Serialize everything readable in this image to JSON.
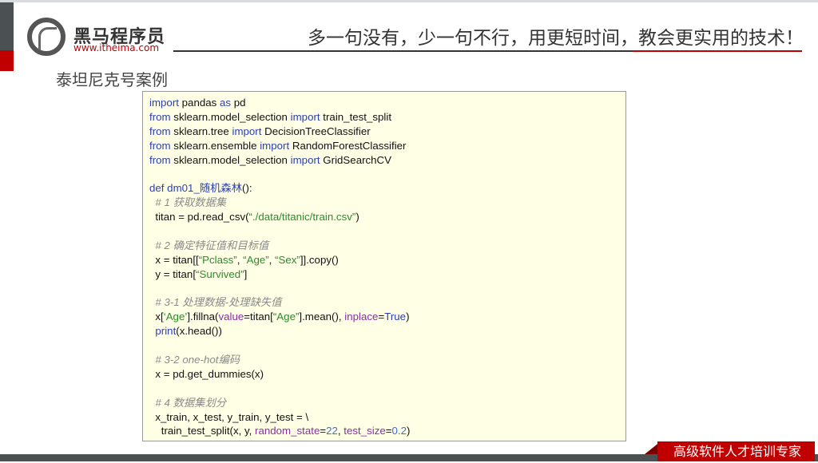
{
  "header": {
    "brand": "黑马程序员",
    "url": "www.itheima.com",
    "slogan": "多一句没有，少一句不行，用更短时间，教会更实用的技术！"
  },
  "title": "泰坦尼克号案例",
  "code_lines": [
    [
      [
        "import",
        "kw"
      ],
      [
        " pandas ",
        ""
      ],
      [
        "as",
        "kw"
      ],
      [
        " pd",
        ""
      ]
    ],
    [
      [
        "from",
        "kw"
      ],
      [
        " sklearn.model_selection ",
        ""
      ],
      [
        "import",
        "kw"
      ],
      [
        " train_test_split",
        ""
      ]
    ],
    [
      [
        "from",
        "kw"
      ],
      [
        " sklearn.tree ",
        ""
      ],
      [
        "import",
        "kw"
      ],
      [
        " DecisionTreeClassifier",
        ""
      ]
    ],
    [
      [
        "from",
        "kw"
      ],
      [
        " sklearn.ensemble ",
        ""
      ],
      [
        "import",
        "kw"
      ],
      [
        " RandomForestClassifier",
        ""
      ]
    ],
    [
      [
        "from",
        "kw"
      ],
      [
        " sklearn.model_selection ",
        ""
      ],
      [
        "import",
        "kw"
      ],
      [
        " GridSearchCV",
        ""
      ]
    ],
    [],
    [
      [
        "def dm01_随机森林",
        "kw"
      ],
      [
        "():",
        ""
      ]
    ],
    [
      [
        "  # 1 获取数据集",
        "cm"
      ]
    ],
    [
      [
        "  titan = pd.read_csv(",
        ""
      ],
      [
        "“./data/titanic/train.csv”",
        "str"
      ],
      [
        ")",
        ""
      ]
    ],
    [],
    [
      [
        "  # 2 确定特征值和目标值",
        "cm"
      ]
    ],
    [
      [
        "  x = titan[[",
        ""
      ],
      [
        "“Pclass”",
        "str"
      ],
      [
        ", ",
        ""
      ],
      [
        "“Age”",
        "str"
      ],
      [
        ", ",
        ""
      ],
      [
        "“Sex”",
        "str"
      ],
      [
        "]].copy()",
        ""
      ]
    ],
    [
      [
        "  y = titan[",
        ""
      ],
      [
        "“Survived”",
        "str"
      ],
      [
        "]",
        ""
      ]
    ],
    [],
    [
      [
        "  # 3-1 处理数据-处理缺失值",
        "cm"
      ]
    ],
    [
      [
        "  x[",
        ""
      ],
      [
        "‘Age’",
        "str"
      ],
      [
        "].fillna(",
        ""
      ],
      [
        "value",
        "par"
      ],
      [
        "=titan[",
        ""
      ],
      [
        "“Age”",
        "str"
      ],
      [
        "].mean(), ",
        ""
      ],
      [
        "inplace",
        "par"
      ],
      [
        "=",
        ""
      ],
      [
        "True",
        "kw"
      ],
      [
        ")",
        ""
      ]
    ],
    [
      [
        "  ",
        ""
      ],
      [
        "print",
        "kw"
      ],
      [
        "(x.head())",
        ""
      ]
    ],
    [],
    [
      [
        "  # 3-2 one-hot编码",
        "cm"
      ]
    ],
    [
      [
        "  x = pd.get_dummies(x)",
        ""
      ]
    ],
    [],
    [
      [
        "  # 4 数据集划分",
        "cm"
      ]
    ],
    [
      [
        "  x_train, x_test, y_train, y_test = \\",
        ""
      ]
    ],
    [
      [
        "    train_test_split(x, y, ",
        ""
      ],
      [
        "random_state",
        "par"
      ],
      [
        "=",
        ""
      ],
      [
        "22",
        "num"
      ],
      [
        ", ",
        ""
      ],
      [
        "test_size",
        "par"
      ],
      [
        "=",
        ""
      ],
      [
        "0.2",
        "num"
      ],
      [
        ")",
        ""
      ]
    ]
  ],
  "footer": {
    "ribbon": "高级软件人才培训专家"
  }
}
